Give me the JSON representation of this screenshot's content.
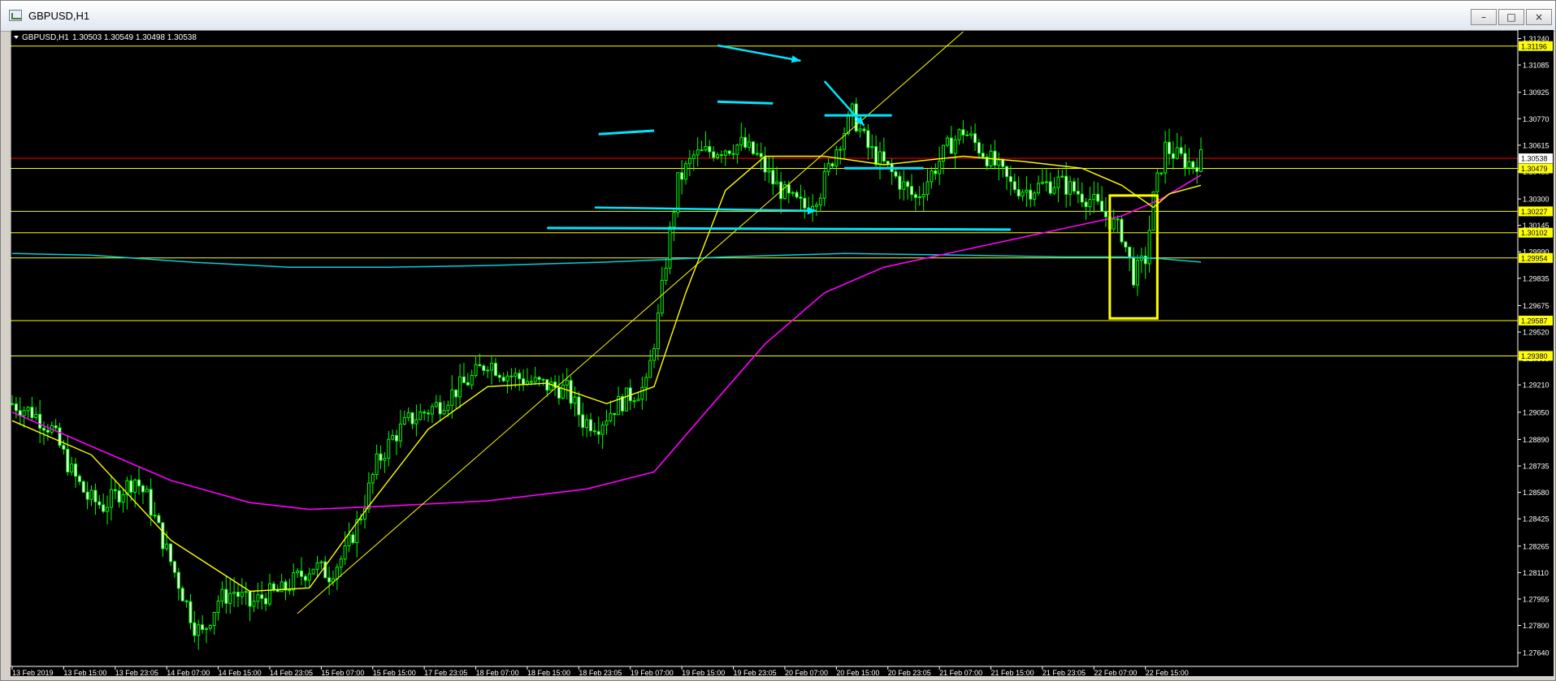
{
  "window": {
    "title": "GBPUSD,H1",
    "controls": {
      "minimize": "–",
      "maximize": "□",
      "close": "×"
    }
  },
  "chart_info": {
    "symbol": "GBPUSD,H1",
    "ohlc": "1.30503 1.30549 1.30498 1.30538"
  },
  "colors": {
    "background": "#000000",
    "candle": "#00ff00",
    "ma_fast": "#ffff00",
    "ma_slow": "#ff00ff",
    "ma_long": "#00d0e0",
    "hline": "#ffff00",
    "price_line": "#ff0000",
    "drawing": "#00e5ff",
    "trendline": "#ffff00",
    "highlight_box": "#ffff00"
  },
  "chart_data": {
    "type": "candlestick",
    "ylim": [
      1.2756,
      1.3129
    ],
    "y_ticks": [
      "1.31240",
      "1.31085",
      "1.30925",
      "1.30770",
      "1.30615",
      "1.30460",
      "1.30300",
      "1.30145",
      "1.29990",
      "1.29835",
      "1.29675",
      "1.29520",
      "1.29365",
      "1.29210",
      "1.29050",
      "1.28890",
      "1.28735",
      "1.28580",
      "1.28425",
      "1.28265",
      "1.28110",
      "1.27955",
      "1.27800",
      "1.27640"
    ],
    "x_ticks": [
      "13 Feb 2019",
      "13 Feb 15:00",
      "13 Feb 23:05",
      "14 Feb 07:00",
      "14 Feb 15:00",
      "14 Feb 23:05",
      "15 Feb 07:00",
      "15 Feb 15:00",
      "17 Feb 23:05",
      "18 Feb 07:00",
      "18 Feb 15:00",
      "18 Feb 23:05",
      "19 Feb 07:00",
      "19 Feb 15:00",
      "19 Feb 23:05",
      "20 Feb 07:00",
      "20 Feb 15:00",
      "20 Feb 23:05",
      "21 Feb 07:00",
      "21 Feb 15:00",
      "21 Feb 23:05",
      "22 Feb 07:00",
      "22 Feb 15:00"
    ],
    "current_price": "1.30538",
    "horizontal_levels": [
      "1.31196",
      "1.30479",
      "1.30227",
      "1.30102",
      "1.29954",
      "1.29587",
      "1.29380"
    ],
    "close_path": [
      [
        0,
        1.291
      ],
      [
        5,
        1.2905
      ],
      [
        10,
        1.2895
      ],
      [
        15,
        1.287
      ],
      [
        19,
        1.2855
      ],
      [
        23,
        1.285
      ],
      [
        27,
        1.2858
      ],
      [
        31,
        1.2866
      ],
      [
        34,
        1.2855
      ],
      [
        38,
        1.283
      ],
      [
        42,
        1.2805
      ],
      [
        46,
        1.278
      ],
      [
        48,
        1.2775
      ],
      [
        52,
        1.2795
      ],
      [
        56,
        1.28
      ],
      [
        60,
        1.2792
      ],
      [
        64,
        1.2798
      ],
      [
        68,
        1.28
      ],
      [
        72,
        1.2808
      ],
      [
        76,
        1.2815
      ],
      [
        80,
        1.281
      ],
      [
        84,
        1.2822
      ],
      [
        88,
        1.2845
      ],
      [
        92,
        1.2875
      ],
      [
        96,
        1.289
      ],
      [
        100,
        1.29
      ],
      [
        104,
        1.2905
      ],
      [
        108,
        1.291
      ],
      [
        112,
        1.2918
      ],
      [
        116,
        1.2925
      ],
      [
        120,
        1.2935
      ],
      [
        124,
        1.2928
      ],
      [
        128,
        1.2925
      ],
      [
        132,
        1.2922
      ],
      [
        136,
        1.292
      ],
      [
        140,
        1.2918
      ],
      [
        144,
        1.29
      ],
      [
        148,
        1.2898
      ],
      [
        152,
        1.2908
      ],
      [
        156,
        1.2915
      ],
      [
        160,
        1.292
      ],
      [
        163,
        1.296
      ],
      [
        166,
        1.301
      ],
      [
        168,
        1.304
      ],
      [
        172,
        1.3055
      ],
      [
        176,
        1.3058
      ],
      [
        180,
        1.306
      ],
      [
        184,
        1.3062
      ],
      [
        188,
        1.3055
      ],
      [
        192,
        1.304
      ],
      [
        196,
        1.303
      ],
      [
        200,
        1.3025
      ],
      [
        204,
        1.3035
      ],
      [
        208,
        1.306
      ],
      [
        212,
        1.308
      ],
      [
        216,
        1.306
      ],
      [
        220,
        1.305
      ],
      [
        224,
        1.304
      ],
      [
        228,
        1.303
      ],
      [
        232,
        1.3045
      ],
      [
        236,
        1.306
      ],
      [
        240,
        1.307
      ],
      [
        244,
        1.306
      ],
      [
        248,
        1.305
      ],
      [
        252,
        1.3038
      ],
      [
        256,
        1.3035
      ],
      [
        260,
        1.3038
      ],
      [
        264,
        1.304
      ],
      [
        268,
        1.3035
      ],
      [
        272,
        1.303
      ],
      [
        276,
        1.302
      ],
      [
        280,
        1.301
      ],
      [
        283,
        1.2985
      ],
      [
        286,
        1.2995
      ],
      [
        288,
        1.303
      ],
      [
        291,
        1.306
      ],
      [
        294,
        1.3055
      ],
      [
        298,
        1.305
      ],
      [
        300,
        1.3054
      ]
    ],
    "ma_fast": [
      [
        0,
        1.29
      ],
      [
        20,
        1.288
      ],
      [
        40,
        1.283
      ],
      [
        60,
        1.28
      ],
      [
        75,
        1.2802
      ],
      [
        90,
        1.285
      ],
      [
        105,
        1.2895
      ],
      [
        120,
        1.292
      ],
      [
        135,
        1.2922
      ],
      [
        150,
        1.291
      ],
      [
        162,
        1.292
      ],
      [
        170,
        1.2975
      ],
      [
        180,
        1.3035
      ],
      [
        190,
        1.3055
      ],
      [
        205,
        1.3055
      ],
      [
        220,
        1.305
      ],
      [
        240,
        1.3055
      ],
      [
        255,
        1.3052
      ],
      [
        270,
        1.3048
      ],
      [
        280,
        1.3038
      ],
      [
        288,
        1.3025
      ],
      [
        292,
        1.3033
      ],
      [
        300,
        1.3038
      ]
    ],
    "ma_slow": [
      [
        0,
        1.2905
      ],
      [
        20,
        1.2885
      ],
      [
        40,
        1.2865
      ],
      [
        60,
        1.2852
      ],
      [
        75,
        1.2848
      ],
      [
        95,
        1.285
      ],
      [
        120,
        1.2853
      ],
      [
        145,
        1.286
      ],
      [
        162,
        1.287
      ],
      [
        175,
        1.2905
      ],
      [
        190,
        1.2945
      ],
      [
        205,
        1.2975
      ],
      [
        220,
        1.299
      ],
      [
        240,
        1.3
      ],
      [
        260,
        1.301
      ],
      [
        280,
        1.302
      ],
      [
        290,
        1.303
      ],
      [
        300,
        1.3044
      ]
    ],
    "ma_long": [
      [
        0,
        1.2998
      ],
      [
        20,
        1.2997
      ],
      [
        45,
        1.2993
      ],
      [
        70,
        1.299
      ],
      [
        95,
        1.299
      ],
      [
        120,
        1.2991
      ],
      [
        150,
        1.2993
      ],
      [
        180,
        1.2996
      ],
      [
        210,
        1.2998
      ],
      [
        240,
        1.2997
      ],
      [
        265,
        1.2996
      ],
      [
        280,
        1.2996
      ],
      [
        290,
        1.2995
      ],
      [
        300,
        1.2993
      ]
    ]
  }
}
